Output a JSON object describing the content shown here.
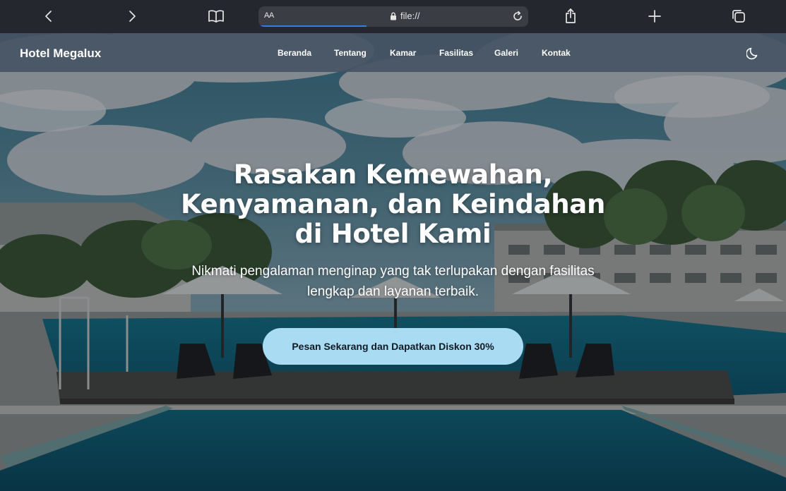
{
  "browser": {
    "address_aa": "AA",
    "url": "file://",
    "load_progress": 0.4
  },
  "navbar": {
    "brand": "Hotel Megalux",
    "links": [
      "Beranda",
      "Tentang",
      "Kamar",
      "Fasilitas",
      "Galeri",
      "Kontak"
    ],
    "theme_icon": "moon-icon"
  },
  "hero": {
    "title": "Rasakan Kemewahan, Kenyamanan, dan Keindahan di Hotel Kami",
    "subtitle": "Nikmati pengalaman menginap yang tak terlupakan dengan fasilitas lengkap dan layanan terbaik.",
    "cta": "Pesan Sekarang dan Dapatkan Diskon 30%"
  },
  "colors": {
    "chrome_bg": "#24272d",
    "navbar_bg": "#465464",
    "cta_bg": "#a9dcf3",
    "progress": "#2f7fe6"
  }
}
